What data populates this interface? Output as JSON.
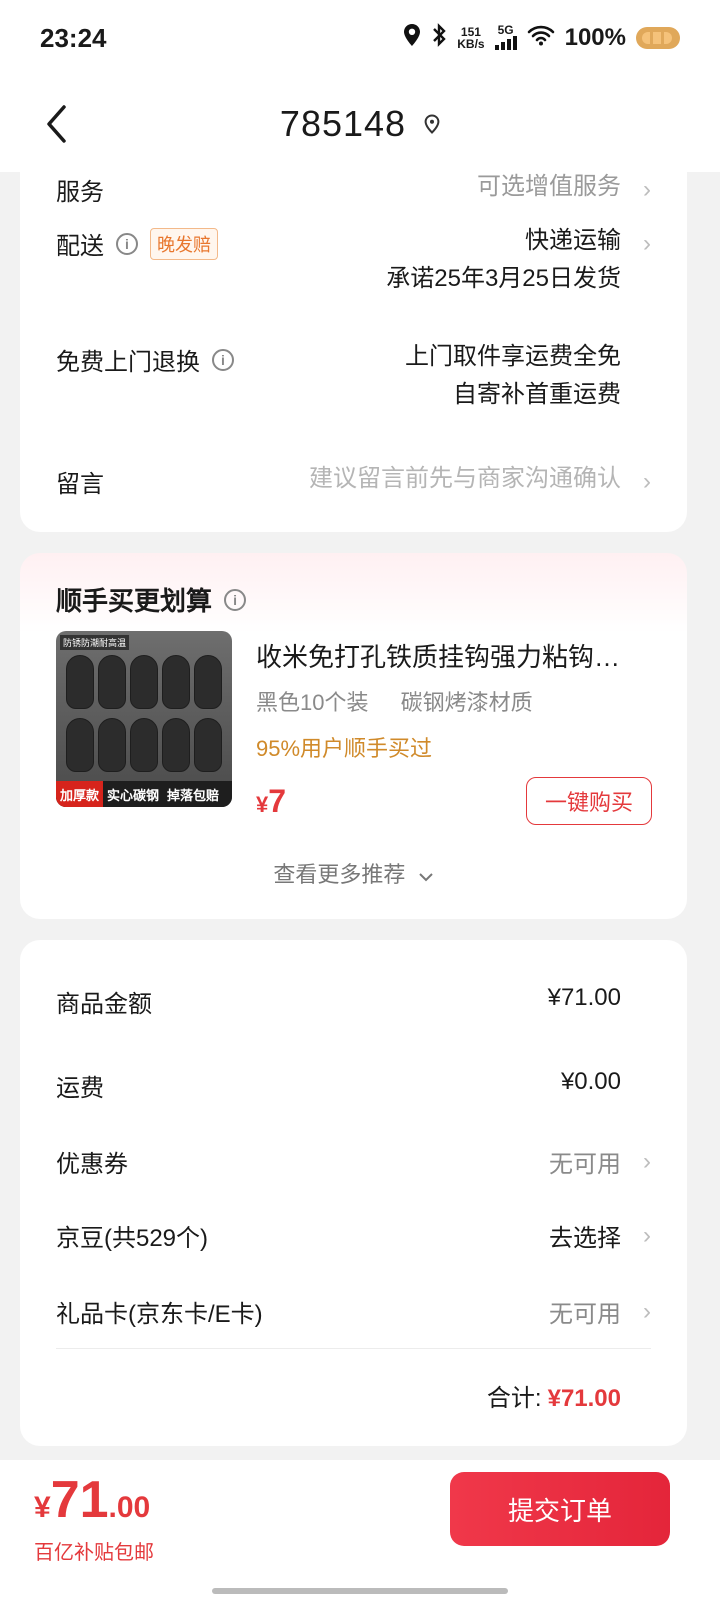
{
  "status_bar": {
    "time": "23:24",
    "net_speed_value": "151",
    "net_speed_unit": "KB/s",
    "network": "5G",
    "battery": "100%"
  },
  "header": {
    "title": "785148"
  },
  "order_info": {
    "service": {
      "label": "服务",
      "value": "可选增值服务"
    },
    "delivery": {
      "label": "配送",
      "tag": "晚发赔",
      "value": "快递运输",
      "promise": "承诺25年3月25日发货"
    },
    "free_return": {
      "label": "免费上门退换",
      "value_line1": "上门取件享运费全免",
      "value_line2": "自寄补首重运费"
    },
    "message": {
      "label": "留言",
      "placeholder": "建议留言前先与商家沟通确认"
    }
  },
  "recommend": {
    "title": "顺手买更划算",
    "product": {
      "name": "收米免打孔铁质挂钩强力粘钩…",
      "spec1": "黑色10个装",
      "spec2": "碳钢烤漆材质",
      "social": "95%用户顺手买过",
      "price_symbol": "¥",
      "price": "7",
      "buy_label": "一键购买",
      "image_badge": "防锈防潮耐高温",
      "image_strip1": "加厚款",
      "image_strip2": "实心碳钢",
      "image_strip3": "掉落包赔"
    },
    "more_label": "查看更多推荐"
  },
  "summary": {
    "goods_amount": {
      "label": "商品金额",
      "value": "¥71.00"
    },
    "shipping": {
      "label": "运费",
      "value": "¥0.00"
    },
    "coupon": {
      "label": "优惠券",
      "value": "无可用"
    },
    "jd_beans": {
      "label": "京豆(共529个)",
      "value": "去选择"
    },
    "gift_card": {
      "label": "礼品卡(京东卡/E卡)",
      "value": "无可用"
    },
    "total_label": "合计:",
    "total_value": "¥71.00"
  },
  "bottom_bar": {
    "price_symbol": "¥",
    "price_int": "71",
    "price_dec": ".00",
    "subsidy": "百亿补贴包邮",
    "submit_label": "提交订单"
  },
  "colors": {
    "accent_red": "#e4393c",
    "muted_text": "#9a9a9a",
    "social_proof": "#d08a2a"
  }
}
